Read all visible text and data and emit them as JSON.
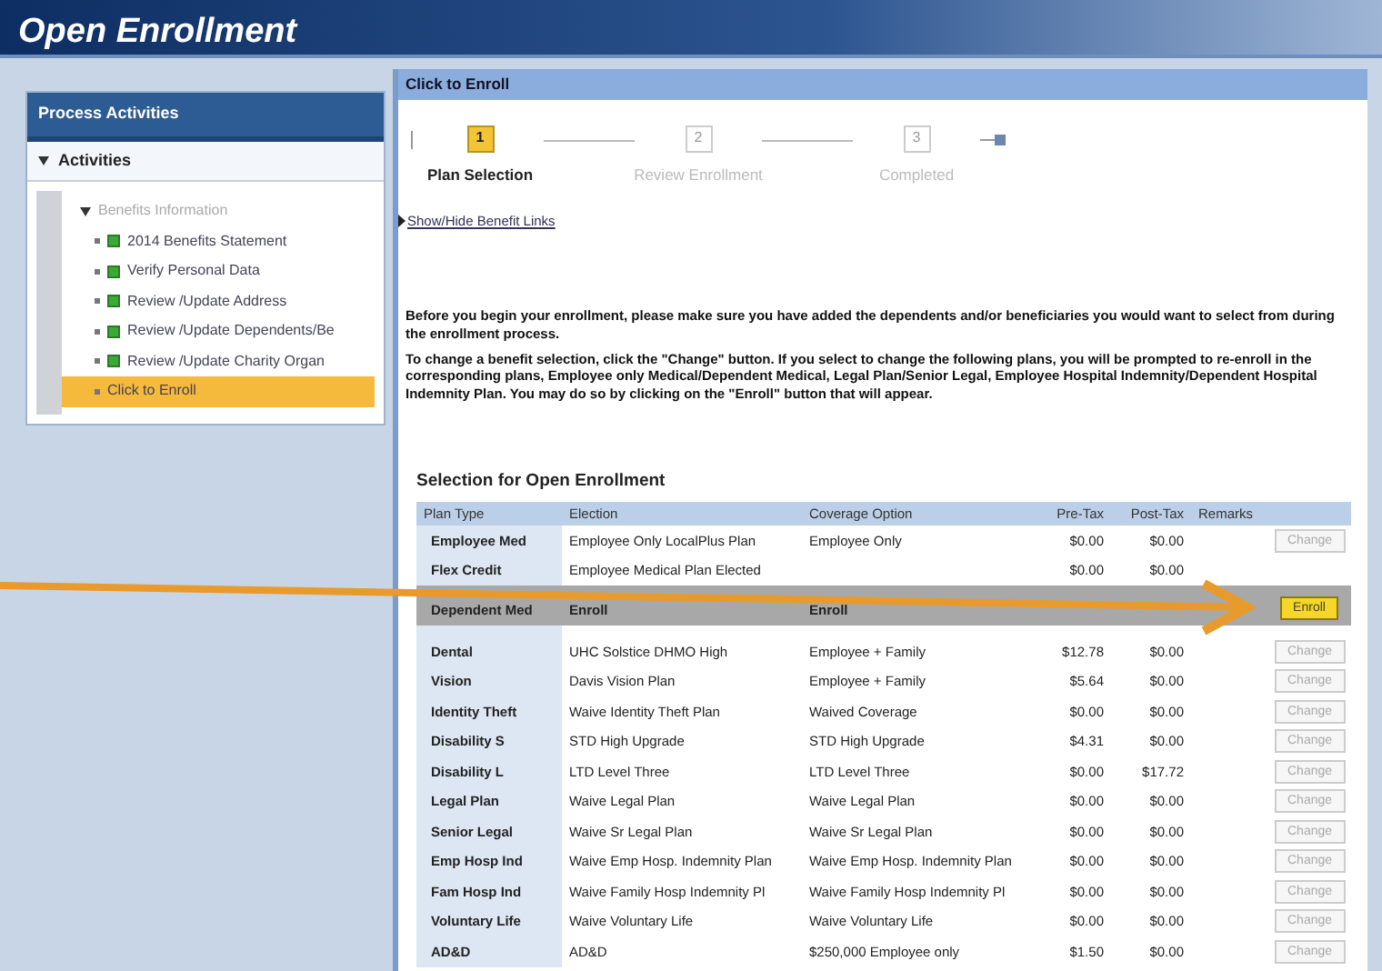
{
  "window": {
    "title": "Open Enrollment"
  },
  "sidebar": {
    "header": "Process Activities",
    "section": {
      "label": "Activities",
      "expanded": true
    },
    "tree": [
      {
        "label": "Benefits Information",
        "expanded": true,
        "complete": false,
        "selected": false,
        "disabled": true,
        "children": [
          {
            "label": "2014 Benefits Statement",
            "complete": true,
            "selected": false,
            "disabled": false
          },
          {
            "label": "Verify Personal Data",
            "complete": true,
            "selected": false,
            "disabled": false
          },
          {
            "label": "Review /Update Address",
            "complete": true,
            "selected": false,
            "disabled": false
          },
          {
            "label": "Review /Update Dependents/Be",
            "complete": true,
            "selected": false,
            "disabled": false
          },
          {
            "label": "Review /Update Charity Organ",
            "complete": true,
            "selected": false,
            "disabled": false
          },
          {
            "label": "Click to Enroll",
            "complete": false,
            "selected": true,
            "disabled": false
          }
        ]
      }
    ]
  },
  "panel": {
    "title": "Click to Enroll",
    "steps": [
      {
        "number": "1",
        "label": "Plan Selection",
        "selected": true
      },
      {
        "number": "2",
        "label": "Review Enrollment",
        "selected": false
      },
      {
        "number": "3",
        "label": "Completed",
        "selected": false
      }
    ],
    "link": "Show/Hide Benefit Links",
    "paragraphs": [
      "Before you begin your enrollment, please make sure you have added the dependents and/or beneficiaries you would want to select from during the enrollment process.",
      "To change a benefit selection, click the \"Change\" button.  If you select to change the following plans, you will be prompted to re-enroll in the corresponding plans, Employee only Medical/Dependent Medical, Legal Plan/Senior Legal, Employee Hospital Indemnity/Dependent Hospital Indemnity Plan.  You may do so by clicking on the \"Enroll\" button that will appear."
    ],
    "table": {
      "title": "Selection for Open Enrollment",
      "columns": [
        "Plan Type",
        "Election",
        "Coverage Option",
        "Pre-Tax",
        "Post-Tax",
        "Remarks"
      ],
      "rows": [
        {
          "plan": "Employee Med",
          "election": "Employee Only LocalPlus Plan",
          "coverage": "Employee Only",
          "pre_tax": "$0.00",
          "post_tax": "$0.00",
          "selected": false,
          "button": {
            "kind": "change",
            "label": "Change"
          }
        },
        {
          "plan": "Flex Credit",
          "election": "Employee Medical Plan Elected",
          "pre_tax": "$0.00",
          "post_tax": "$0.00",
          "selected": false
        },
        {
          "plan": "Dependent Med",
          "election": "Enroll",
          "coverage": "Enroll",
          "selected": true,
          "button": {
            "kind": "enroll",
            "label": "Enroll"
          }
        },
        {
          "plan": "Dental",
          "election": "UHC Solstice DHMO High",
          "coverage": "Employee + Family",
          "pre_tax": "$12.78",
          "post_tax": "$0.00",
          "selected": false,
          "button": {
            "kind": "change",
            "label": "Change"
          }
        },
        {
          "plan": "Vision",
          "election": "Davis Vision Plan",
          "coverage": "Employee + Family",
          "pre_tax": "$5.64",
          "post_tax": "$0.00",
          "selected": false,
          "button": {
            "kind": "change",
            "label": "Change"
          }
        },
        {
          "plan": "Identity Theft",
          "election": "Waive Identity Theft Plan",
          "coverage": "Waived Coverage",
          "pre_tax": "$0.00",
          "post_tax": "$0.00",
          "selected": false,
          "button": {
            "kind": "change",
            "label": "Change"
          }
        },
        {
          "plan": "Disability S",
          "election": "STD High Upgrade",
          "coverage": "STD High Upgrade",
          "pre_tax": "$4.31",
          "post_tax": "$0.00",
          "selected": false,
          "button": {
            "kind": "change",
            "label": "Change"
          }
        },
        {
          "plan": "Disability L",
          "election": "LTD Level Three",
          "coverage": "LTD Level Three",
          "pre_tax": "$0.00",
          "post_tax": "$17.72",
          "selected": false,
          "button": {
            "kind": "change",
            "label": "Change"
          }
        },
        {
          "plan": "Legal Plan",
          "election": "Waive Legal Plan",
          "coverage": "Waive Legal Plan",
          "pre_tax": "$0.00",
          "post_tax": "$0.00",
          "selected": false,
          "button": {
            "kind": "change",
            "label": "Change"
          }
        },
        {
          "plan": "Senior Legal",
          "election": "Waive Sr Legal Plan",
          "coverage": "Waive Sr Legal Plan",
          "pre_tax": "$0.00",
          "post_tax": "$0.00",
          "selected": false,
          "button": {
            "kind": "change",
            "label": "Change"
          }
        },
        {
          "plan": "Emp Hosp Ind",
          "election": "Waive Emp Hosp. Indemnity Plan",
          "coverage": "Waive Emp Hosp. Indemnity Plan",
          "pre_tax": "$0.00",
          "post_tax": "$0.00",
          "selected": false,
          "button": {
            "kind": "change",
            "label": "Change"
          }
        },
        {
          "plan": "Fam Hosp Ind",
          "election": "Waive Family Hosp Indemnity Pl",
          "coverage": "Waive Family Hosp Indemnity Pl",
          "pre_tax": "$0.00",
          "post_tax": "$0.00",
          "selected": false,
          "button": {
            "kind": "change",
            "label": "Change"
          }
        },
        {
          "plan": "Voluntary Life",
          "election": "Waive Voluntary Life",
          "coverage": "Waive Voluntary Life",
          "pre_tax": "$0.00",
          "post_tax": "$0.00",
          "selected": false,
          "button": {
            "kind": "change",
            "label": "Change"
          }
        },
        {
          "plan": "AD&D",
          "election": "AD&D",
          "coverage": "$250,000 Employee only",
          "pre_tax": "$1.50",
          "post_tax": "$0.00",
          "selected": false,
          "button": {
            "kind": "change",
            "label": "Change"
          }
        }
      ]
    }
  }
}
